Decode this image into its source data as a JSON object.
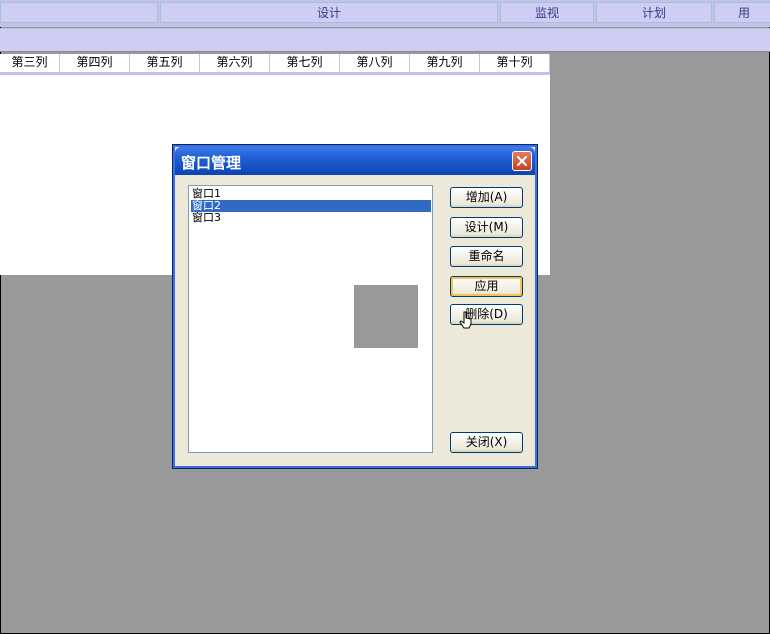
{
  "top_tabs": [
    {
      "label": ""
    },
    {
      "label": "设计"
    },
    {
      "label": "监视"
    },
    {
      "label": "计划"
    },
    {
      "label": "用"
    }
  ],
  "columns": [
    "第三列",
    "第四列",
    "第五列",
    "第六列",
    "第七列",
    "第八列",
    "第九列",
    "第十列"
  ],
  "dialog": {
    "title": "窗口管理",
    "list_items": [
      "窗口1",
      "窗口2",
      "窗口3"
    ],
    "selected_index": 1,
    "buttons": {
      "add": "增加(A)",
      "design": "设计(M)",
      "rename": "重命名",
      "apply": "应用",
      "delete": "删除(D)",
      "close": "关闭(X)"
    }
  },
  "colors": {
    "tab_bg": "#cfcdf6",
    "desktop": "#999999",
    "title_blue": "#2464d8",
    "selection": "#316ac5"
  },
  "icons": [
    "close-icon",
    "cursor-icon"
  ]
}
